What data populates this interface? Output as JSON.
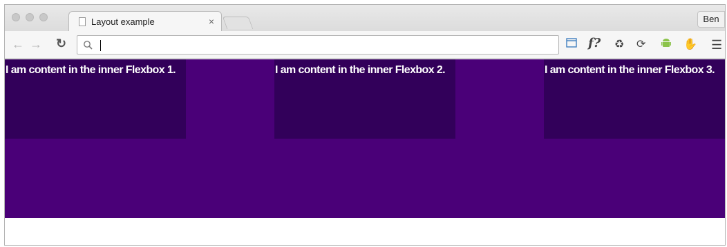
{
  "browser": {
    "profile_label": "Ben",
    "tabs": [
      {
        "title": "Layout example",
        "close_label": "×"
      }
    ],
    "toolbar": {
      "back_icon": "back-arrow-icon",
      "forward_icon": "forward-arrow-icon",
      "reload_icon": "reload-icon",
      "omnibox_value": "",
      "search_icon": "search-icon",
      "extensions": [
        "devtools-icon",
        "fx-icon",
        "recycle-icon",
        "sync-icon",
        "android-icon",
        "hand-icon",
        "menu-icon"
      ],
      "fx_label": "f?"
    }
  },
  "page": {
    "outer_flex_color": "#4a0078",
    "inner_flex_color": "#32005a",
    "inner_flexboxes": [
      {
        "text": "I am content in the inner Flexbox 1."
      },
      {
        "text": "I am content in the inner Flexbox 2."
      },
      {
        "text": "I am content in the inner Flexbox 3."
      }
    ]
  }
}
